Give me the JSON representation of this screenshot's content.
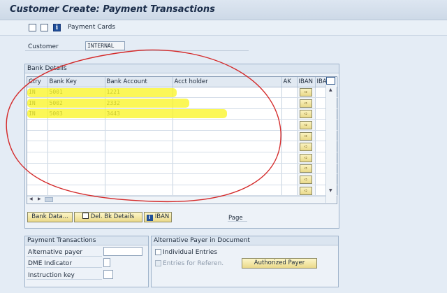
{
  "window": {
    "title": "Customer Create: Payment Transactions"
  },
  "toolbar": {
    "payment_cards_label": "Payment Cards"
  },
  "customer": {
    "label": "Customer",
    "value": "INTERNAL"
  },
  "bank_details": {
    "group_title": "Bank Details",
    "columns": [
      "Ctry",
      "Bank Key",
      "Bank Account",
      "Acct holder",
      "AK",
      "IBAN",
      "IBA"
    ],
    "rows": [
      {
        "ctry": "IN",
        "bank_key": "5001",
        "bank_account": "1221",
        "acct_holder": "",
        "ak": ""
      },
      {
        "ctry": "IN",
        "bank_key": "5002",
        "bank_account": "2332",
        "acct_holder": "",
        "ak": ""
      },
      {
        "ctry": "IN",
        "bank_key": "5003",
        "bank_account": "3443",
        "acct_holder": "",
        "ak": ""
      },
      {
        "ctry": "",
        "bank_key": "",
        "bank_account": "",
        "acct_holder": "",
        "ak": ""
      },
      {
        "ctry": "",
        "bank_key": "",
        "bank_account": "",
        "acct_holder": "",
        "ak": ""
      },
      {
        "ctry": "",
        "bank_key": "",
        "bank_account": "",
        "acct_holder": "",
        "ak": ""
      },
      {
        "ctry": "",
        "bank_key": "",
        "bank_account": "",
        "acct_holder": "",
        "ak": ""
      },
      {
        "ctry": "",
        "bank_key": "",
        "bank_account": "",
        "acct_holder": "",
        "ak": ""
      },
      {
        "ctry": "",
        "bank_key": "",
        "bank_account": "",
        "acct_holder": "",
        "ak": ""
      },
      {
        "ctry": "",
        "bank_key": "",
        "bank_account": "",
        "acct_holder": "",
        "ak": ""
      }
    ],
    "iban_button_icon": "arrow-right-icon",
    "buttons": {
      "bank_data": "Bank Data...",
      "del_bk_details": "Del. Bk Details",
      "iban": "IBAN"
    },
    "page_label": "Page"
  },
  "payment_transactions": {
    "group_title": "Payment Transactions",
    "alternative_payer_label": "Alternative payer",
    "alternative_payer_value": "",
    "dme_indicator_label": "DME Indicator",
    "dme_indicator_value": "",
    "instruction_key_label": "Instruction key",
    "instruction_key_value": ""
  },
  "alternative_payer_doc": {
    "group_title": "Alternative Payer in Document",
    "individual_entries_label": "Individual Entries",
    "individual_entries_checked": false,
    "entries_for_referen_label": "Entries for Referen.",
    "entries_for_referen_checked": false,
    "authorized_payer_button": "Authorized Payer"
  },
  "colors": {
    "highlight": "#f7f21e",
    "annotation_circle": "#d42a2a",
    "button_fill": "#f3e7a8",
    "title_text": "#1b2d4a"
  }
}
